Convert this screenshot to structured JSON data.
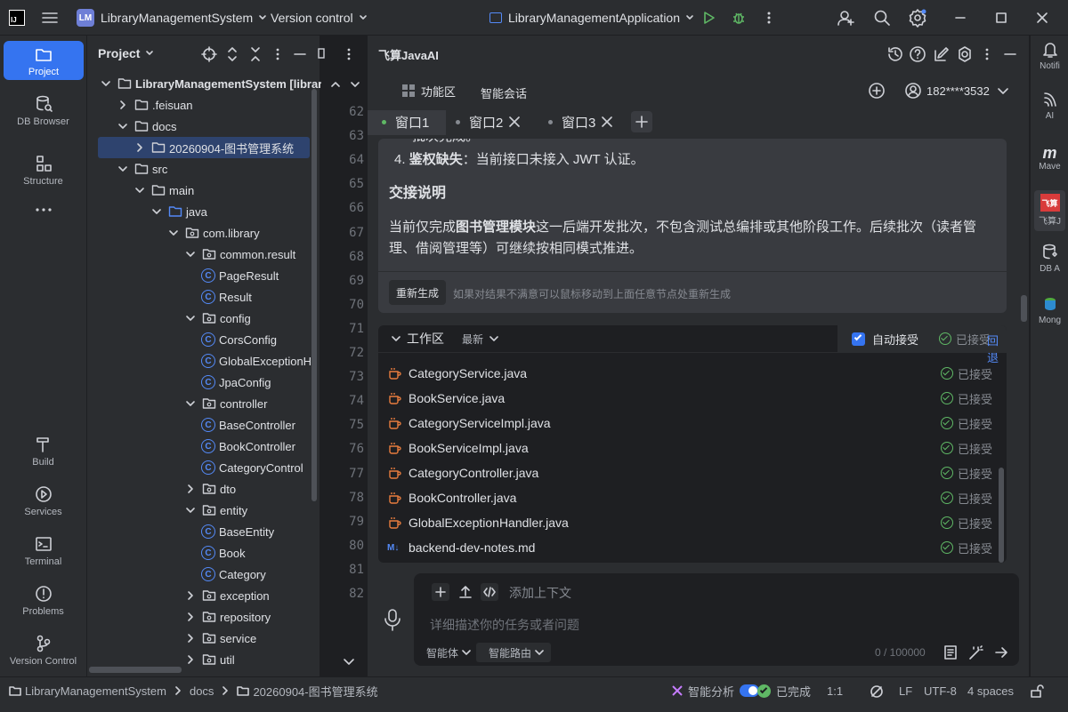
{
  "titlebar": {
    "app_badge": "LM",
    "project_name": "LibraryManagementSystem",
    "vcs": "Version control",
    "run_config": "LibraryManagementApplication"
  },
  "left_tools": [
    {
      "label": "Project",
      "icon": "folder-icon"
    },
    {
      "label": "DB Browser",
      "icon": "database-icon"
    },
    {
      "label": "Structure",
      "icon": "structure-icon"
    },
    {
      "label": "Build",
      "icon": "hammer-icon"
    },
    {
      "label": "Services",
      "icon": "services-icon"
    },
    {
      "label": "Terminal",
      "icon": "terminal-icon"
    },
    {
      "label": "Problems",
      "icon": "problems-icon"
    },
    {
      "label": "Version Control",
      "icon": "vcs-icon"
    }
  ],
  "project": {
    "title": "Project",
    "tree": [
      {
        "label": "LibraryManagementSystem [library-",
        "depth": 0,
        "type": "folder",
        "expanded": true,
        "bold": true
      },
      {
        "label": ".feisuan",
        "depth": 1,
        "type": "folder",
        "expanded": false
      },
      {
        "label": "docs",
        "depth": 1,
        "type": "folder",
        "expanded": true
      },
      {
        "label": "20260904-图书管理系统",
        "depth": 2,
        "type": "folder",
        "expanded": false,
        "selected": true
      },
      {
        "label": "src",
        "depth": 1,
        "type": "folder",
        "expanded": true
      },
      {
        "label": "main",
        "depth": 2,
        "type": "folder",
        "expanded": true
      },
      {
        "label": "java",
        "depth": 3,
        "type": "src",
        "expanded": true
      },
      {
        "label": "com.library",
        "depth": 4,
        "type": "pkg",
        "expanded": true
      },
      {
        "label": "common.result",
        "depth": 5,
        "type": "pkg",
        "expanded": true
      },
      {
        "label": "PageResult",
        "depth": 6,
        "type": "class"
      },
      {
        "label": "Result",
        "depth": 6,
        "type": "class"
      },
      {
        "label": "config",
        "depth": 5,
        "type": "pkg",
        "expanded": true
      },
      {
        "label": "CorsConfig",
        "depth": 6,
        "type": "class"
      },
      {
        "label": "GlobalExceptionH",
        "depth": 6,
        "type": "class"
      },
      {
        "label": "JpaConfig",
        "depth": 6,
        "type": "class"
      },
      {
        "label": "controller",
        "depth": 5,
        "type": "pkg",
        "expanded": true
      },
      {
        "label": "BaseController",
        "depth": 6,
        "type": "class"
      },
      {
        "label": "BookController",
        "depth": 6,
        "type": "class"
      },
      {
        "label": "CategoryControl",
        "depth": 6,
        "type": "class"
      },
      {
        "label": "dto",
        "depth": 5,
        "type": "pkg",
        "expanded": false
      },
      {
        "label": "entity",
        "depth": 5,
        "type": "pkg",
        "expanded": true
      },
      {
        "label": "BaseEntity",
        "depth": 6,
        "type": "class"
      },
      {
        "label": "Book",
        "depth": 6,
        "type": "class"
      },
      {
        "label": "Category",
        "depth": 6,
        "type": "class"
      },
      {
        "label": "exception",
        "depth": 5,
        "type": "pkg",
        "expanded": false
      },
      {
        "label": "repository",
        "depth": 5,
        "type": "pkg",
        "expanded": false
      },
      {
        "label": "service",
        "depth": 5,
        "type": "pkg",
        "expanded": false
      },
      {
        "label": "util",
        "depth": 5,
        "type": "pkg",
        "expanded": false
      }
    ]
  },
  "editor": {
    "line_numbers": [
      "62",
      "63",
      "64",
      "65",
      "66",
      "67",
      "68",
      "69",
      "70",
      "71",
      "72",
      "73",
      "74",
      "75",
      "76",
      "77",
      "78",
      "79",
      "80",
      "81",
      "82"
    ]
  },
  "ai": {
    "title": "飞算JavaAI",
    "func_tab": "功能区",
    "chat_tab": "智能会话",
    "user": "182****3532",
    "tabs": [
      "窗口1",
      "窗口2",
      "窗口3"
    ],
    "msg": {
      "partial": "批次完成。",
      "item4_num": "4.",
      "item4_bold": "鉴权缺失",
      "item4_rest": "：当前接口未接入 JWT 认证。",
      "heading": "交接说明",
      "para_pre": "当前仅完成",
      "para_bold": "图书管理模块",
      "para_line1_rest": "这一后端开发批次，不包含测试总编排或其他阶段工作。后续批次（读者管",
      "para_line2": "理、借阅管理等）可继续按相同模式推进。",
      "regen_button": "重新生成",
      "regen_hint": "如果对结果不满意可以鼠标移动到上面任意节点处重新生成"
    },
    "workspace": {
      "title": "工作区",
      "filter": "最新",
      "auto_accept": "自动接受",
      "accepted_all": "已接受",
      "rollback": "回退",
      "files": [
        {
          "name": "CategoryService.java",
          "status": "已接受",
          "kind": "java"
        },
        {
          "name": "BookService.java",
          "status": "已接受",
          "kind": "java"
        },
        {
          "name": "CategoryServiceImpl.java",
          "status": "已接受",
          "kind": "java"
        },
        {
          "name": "BookServiceImpl.java",
          "status": "已接受",
          "kind": "java"
        },
        {
          "name": "CategoryController.java",
          "status": "已接受",
          "kind": "java"
        },
        {
          "name": "BookController.java",
          "status": "已接受",
          "kind": "java"
        },
        {
          "name": "GlobalExceptionHandler.java",
          "status": "已接受",
          "kind": "java"
        },
        {
          "name": "backend-dev-notes.md",
          "status": "已接受",
          "kind": "md"
        }
      ]
    },
    "input": {
      "context_label": "添加上下文",
      "placeholder": "详细描述你的任务或者问题",
      "agent_select": "智能体",
      "route_select": "智能路由",
      "counter": "0 / 100000"
    }
  },
  "right_tools": [
    {
      "label": "Notifi",
      "icon": "bell-icon"
    },
    {
      "label": "AI",
      "icon": "ai-icon"
    },
    {
      "label": "Mave",
      "icon": "maven-icon"
    },
    {
      "label": "飞算J",
      "icon": "feisuan-icon"
    },
    {
      "label": "DB A",
      "icon": "db-assistant-icon"
    },
    {
      "label": "Mong",
      "icon": "mongo-icon"
    }
  ],
  "statusbar": {
    "crumbs": [
      "LibraryManagementSystem",
      "docs",
      "20260904-图书管理系统"
    ],
    "smart_analysis": "智能分析",
    "done": "已完成",
    "position": "1:1",
    "line_sep": "LF",
    "encoding": "UTF-8",
    "indent": "4 spaces"
  },
  "colors": {
    "accent": "#3574f0",
    "success": "#5fb865",
    "panel": "#2b2d30",
    "editor": "#1e1f22"
  }
}
